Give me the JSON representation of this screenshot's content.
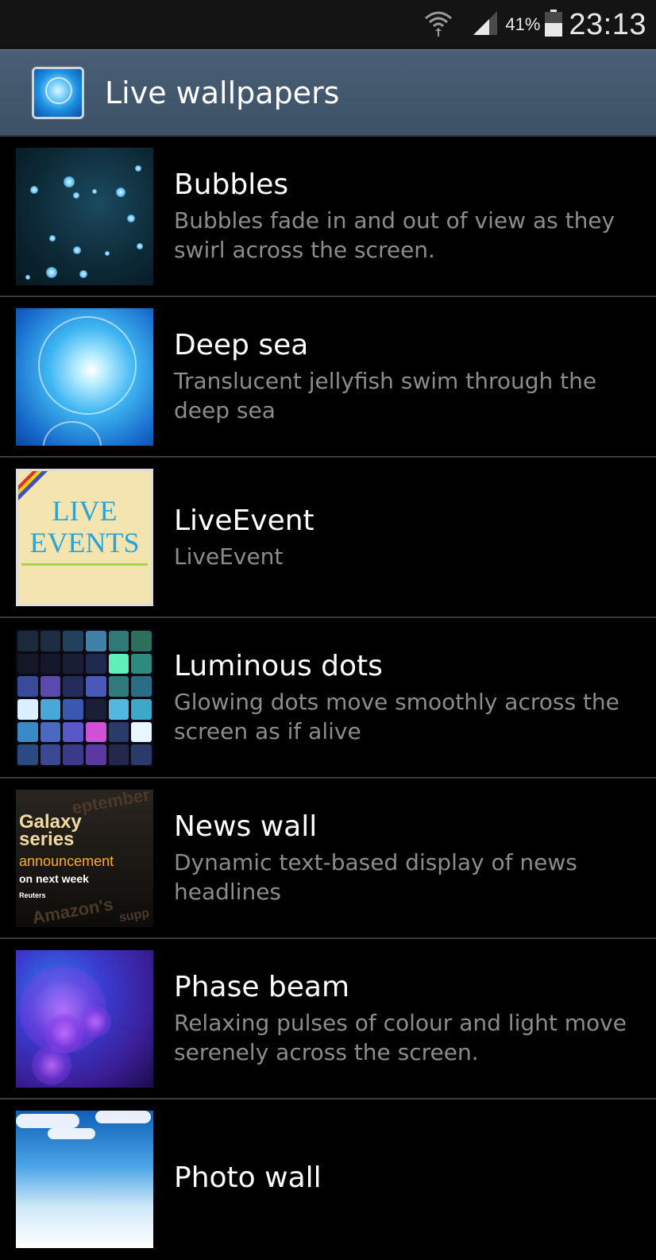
{
  "status_bar": {
    "battery_percent": "41%",
    "time": "23:13",
    "icons": [
      "wifi-icon",
      "signal-icon",
      "battery-icon"
    ]
  },
  "action_bar": {
    "title": "Live wallpapers",
    "icon": "live-wallpaper-app-icon"
  },
  "wallpapers": [
    {
      "title": "Bubbles",
      "description": "Bubbles fade in and out of view as they swirl across the screen."
    },
    {
      "title": "Deep sea",
      "description": "Translucent jellyfish swim through the deep sea"
    },
    {
      "title": "LiveEvent",
      "description": "LiveEvent",
      "thumb_text": [
        "LIVE",
        "EVENTS"
      ]
    },
    {
      "title": "Luminous dots",
      "description": "Glowing dots move smoothly across the screen as if alive"
    },
    {
      "title": "News wall",
      "description": "Dynamic text-based display of news headlines",
      "thumb_text": [
        "Galaxy",
        "series",
        "announcement",
        "on next week",
        "Reuters",
        "eptember",
        "Amazon's",
        "supp"
      ]
    },
    {
      "title": "Phase beam",
      "description": "Relaxing pulses of colour and light move serenely across the screen."
    },
    {
      "title": "Photo wall",
      "description": ""
    }
  ],
  "colors": {
    "status_bar_bg": "#141414",
    "action_bar_bg": "#4a5f75",
    "list_bg": "#000000",
    "title_text": "#ffffff",
    "description_text": "#8c8c8c",
    "divider": "#3a3a3a"
  }
}
